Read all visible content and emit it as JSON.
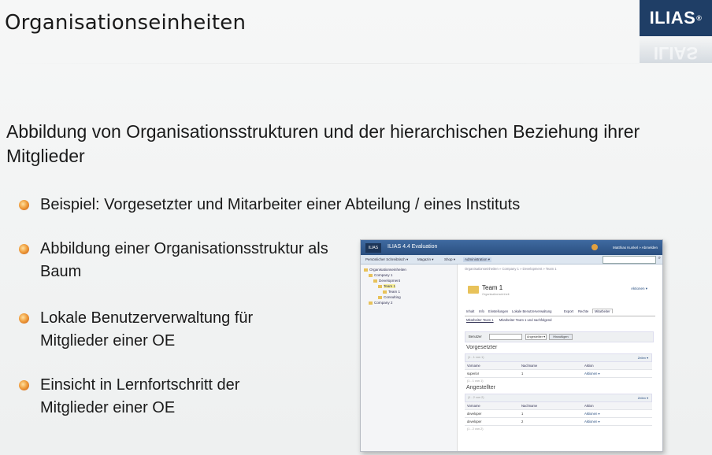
{
  "slide": {
    "title": "Organisationseinheiten",
    "logo_text": "ILIAS",
    "logo_mark": "®",
    "heading": "Abbildung von Organisationsstrukturen und der hierarchischen Beziehung ihrer Mitglieder",
    "bullets": [
      "Beispiel: Vorgesetzter und Mitarbeiter einer Abteilung / eines Instituts",
      "Abbildung einer Organisationsstruktur als Baum",
      "Lokale Benutzerverwaltung für Mitglieder einer OE",
      "Einsicht in Lernfortschritt der Mitglieder einer OE"
    ],
    "colors": {
      "logo_bg": "#1f3e66",
      "bullet": "#e0842a"
    }
  },
  "screenshot": {
    "logo": "ILIAS",
    "app_title": "ILIAS 4.4 Evaluation",
    "user": "Matthias Kunkel » Abmelden",
    "nav": [
      "Persönlicher Schreibtisch ▾",
      "Magazin ▾",
      "Shop ▾",
      "Administration ▾"
    ],
    "search_icon": "search-icon",
    "tree": [
      "Organisationseinheiten",
      "Company 1",
      "Development",
      "Team 1",
      "Team 1",
      "Consulting",
      "Company 2"
    ],
    "breadcrumb": "Organisationseinheiten » Company 1 » Development » Team 1",
    "object_title": "Team 1",
    "object_subtitle": "Organisationseinheit",
    "actions": "Aktionen ▾",
    "tabs": [
      "Inhalt",
      "Info",
      "Einstellungen",
      "Lokale Benutzerverwaltung",
      "Export",
      "Rechte",
      "Mitarbeiter"
    ],
    "subtabs": [
      "Mitarbeiter Team 1",
      "Mitarbeiter Team 1 und nachfolgend"
    ],
    "form": {
      "label": "Benutzer",
      "select": "Angestellter ▾",
      "button": "Hinzufügen"
    },
    "sections": [
      {
        "title": "Vorgesetzter",
        "count_top": "(1 - 1 von 1)",
        "zeilen": "Zeilen ▾",
        "headers": [
          "Vorname",
          "Nachname",
          "Aktion"
        ],
        "rows": [
          [
            "superior",
            "1",
            "Aktionen ▾"
          ]
        ],
        "count_bottom": "(1 - 1 von 1)"
      },
      {
        "title": "Angestellter",
        "count_top": "(1 - 2 von 2)",
        "zeilen": "Zeilen ▾",
        "headers": [
          "Vorname",
          "Nachname",
          "Aktion"
        ],
        "rows": [
          [
            "developer",
            "1",
            "Aktionen ▾"
          ],
          [
            "developer",
            "2",
            "Aktionen ▾"
          ]
        ],
        "count_bottom": "(1 - 2 von 2)"
      }
    ]
  }
}
